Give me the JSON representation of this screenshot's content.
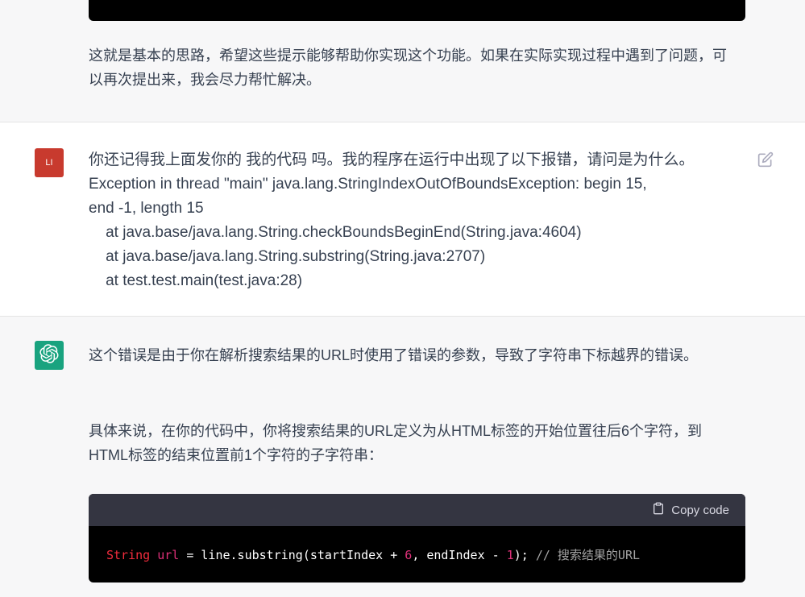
{
  "previous_message": {
    "text": "这就是基本的思路，希望这些提示能够帮助你实现这个功能。如果在实际实现过程中遇到了问题，可以再次提出来，我会尽力帮忙解决。"
  },
  "user_message": {
    "avatar_text": "LI",
    "lines": [
      "你还记得我上面发你的 我的代码 吗。我的程序在运行中出现了以下报错，请问是为什么。",
      "Exception in thread \"main\" java.lang.StringIndexOutOfBoundsException: begin 15,",
      "end -1, length 15",
      "    at java.base/java.lang.String.checkBoundsBeginEnd(String.java:4604)",
      "    at java.base/java.lang.String.substring(String.java:2707)",
      "    at test.test.main(test.java:28)"
    ],
    "edit_icon": "edit-icon"
  },
  "assistant_message": {
    "avatar_icon": "openai-logo-icon",
    "paragraph_1": "这个错误是由于你在解析搜索结果的URL时使用了错误的参数，导致了字符串下标越界的错误。",
    "paragraph_2": "具体来说，在你的代码中，你将搜索结果的URL定义为从HTML标签的开始位置往后6个字符，到HTML标签的结束位置前1个字符的子字符串：",
    "code_block": {
      "copy_label": "Copy code",
      "copy_icon": "clipboard-icon",
      "tokens": {
        "type": "String",
        "var": "url",
        "eq": " = ",
        "call": "line.substring(startIndex + ",
        "num1": "6",
        "mid": ", endIndex - ",
        "num2": "1",
        "close": ");",
        "comment": " // 搜索结果的URL"
      }
    }
  },
  "colors": {
    "user_avatar": "#c83a2e",
    "assistant_avatar": "#19a37f",
    "code_header": "#343541",
    "code_body": "#000000"
  }
}
